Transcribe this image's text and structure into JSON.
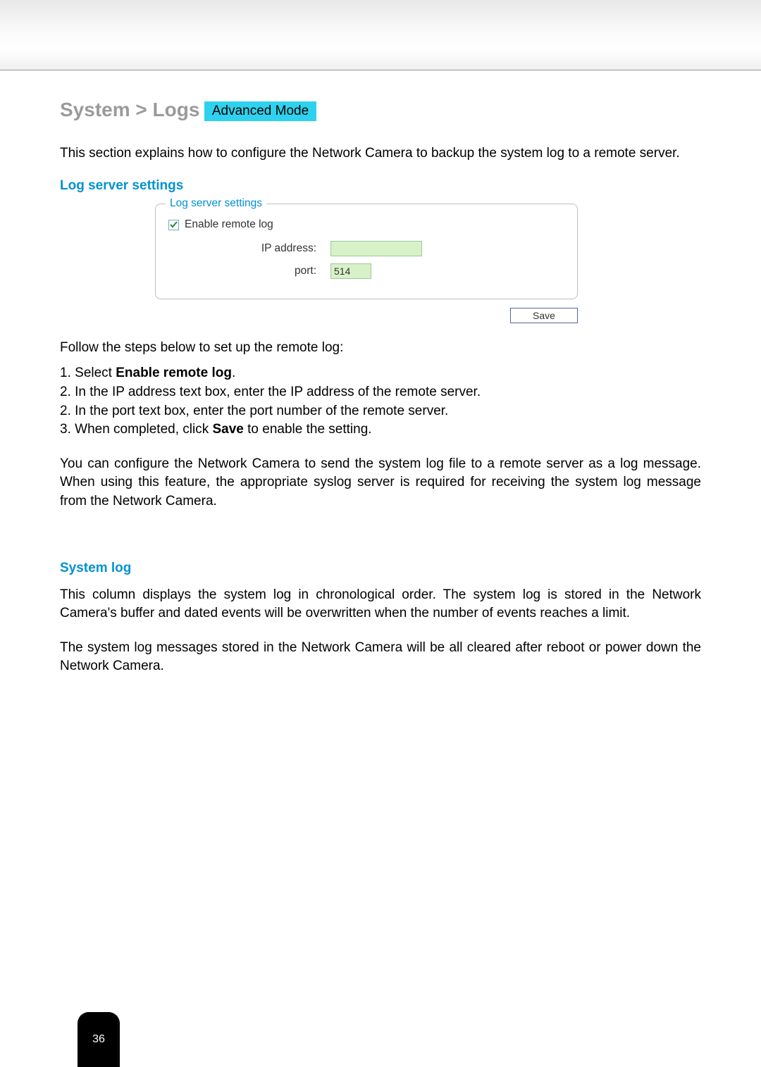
{
  "header": {
    "breadcrumb": "System > Logs",
    "mode_badge": "Advanced Mode"
  },
  "intro": "This section explains how to configure the Network Camera to backup the system log to a remote server.",
  "log_server": {
    "heading": "Log server settings",
    "legend": "Log server settings",
    "enable_label": "Enable remote log",
    "enable_checked": true,
    "ip_label": "IP address:",
    "ip_value": "",
    "port_label": "port:",
    "port_value": "514",
    "save_label": "Save"
  },
  "steps_intro": "Follow the steps below to set up the remote log:",
  "steps": [
    {
      "n": "1.",
      "pre": "Select ",
      "bold": "Enable remote log",
      "post": "."
    },
    {
      "n": "2.",
      "pre": "In the IP address text box, enter the IP address of the remote server.",
      "bold": "",
      "post": ""
    },
    {
      "n": "2.",
      "pre": "In the port text box, enter the port number of the remote server.",
      "bold": "",
      "post": ""
    },
    {
      "n": "3.",
      "pre": "When completed, click ",
      "bold": "Save",
      "post": " to enable the setting."
    }
  ],
  "remote_note": "You can configure the Network Camera to send the system log file to a remote server as a log message. When using this feature, the appropriate syslog server is required for receiving the system log message from the Network Camera.",
  "system_log": {
    "heading": "System log",
    "p1": "This column displays the system log in chronological order. The system log is stored in the Network Camera's buffer and dated events will be overwritten when the number of events reaches a limit.",
    "p2": "The system log messages stored in the Network Camera will be all cleared after reboot or power down the Network Camera."
  },
  "page_number": "36"
}
